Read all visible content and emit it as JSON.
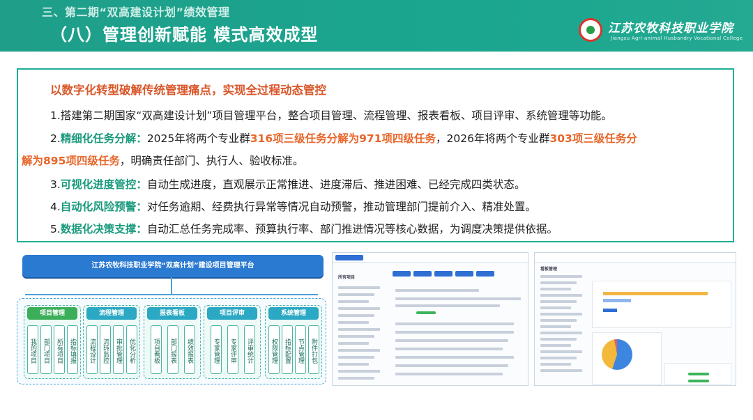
{
  "header": {
    "subtitle": "三、第二期“双高建设计划”绩效管理",
    "title": "（八）管理创新赋能 模式高效成型",
    "school_cn": "江苏农牧科技职业学院",
    "school_en": "Jiangsu Agri-animal Husbandry Vocational College"
  },
  "content": {
    "heading": "以数字化转型破解传统管理痛点，实现全过程动态管控",
    "l1": "1.搭建第二期国家“双高建设计划”项目管理平台，整合项目管理、流程管理、报表看板、项目评审、系统管理等功能。",
    "l2a": "2.",
    "l2b": "精细化任务分解：",
    "l2c": "2025年将两个专业群",
    "l2d": "316项三级任务分解为971项四级任务",
    "l2e": "，2026年将两个专业群",
    "l2f": "303项三级任务分",
    "l3a": "解为895项四级任务",
    "l3b": "，明确责任部门、执行人、验收标准。",
    "l4a": "3.",
    "l4b": "可视化进度管控：",
    "l4c": "自动生成进度，直观展示正常推进、进度滞后、推进困难、已经完成四类状态。",
    "l5a": "4.",
    "l5b": "自动化风险预警：",
    "l5c": "对任务逾期、经费执行异常等情况自动预警，推动管理部门提前介入、精准处置。",
    "l6a": "5.",
    "l6b": "数据化决策支撑：",
    "l6c": "自动汇总任务完成率、预算执行率、部门推进情况等核心数据，为调度决策提供依据。"
  },
  "diagram": {
    "title": "江苏农牧科技职业学院“双高计划”建设项目管理平台",
    "modules": [
      {
        "name": "项目管理",
        "items": [
          "我的项目",
          "部门项目",
          "所有项目",
          "指标填报"
        ]
      },
      {
        "name": "流程管理",
        "items": [
          "流程设计",
          "流转监控",
          "审批管理",
          "优化分析"
        ]
      },
      {
        "name": "报表看板",
        "items": [
          "项目看板",
          "部门报表",
          "绩效报表"
        ]
      },
      {
        "name": "项目评审",
        "items": [
          "专家管理",
          "专家评审",
          "评审统计"
        ]
      },
      {
        "name": "系统管理",
        "items": [
          "权限管理",
          "指标配置",
          "节点管理",
          "附件打包"
        ]
      }
    ]
  },
  "shots": {
    "s1_title": "所有项目",
    "s2_title": "看板管理"
  }
}
